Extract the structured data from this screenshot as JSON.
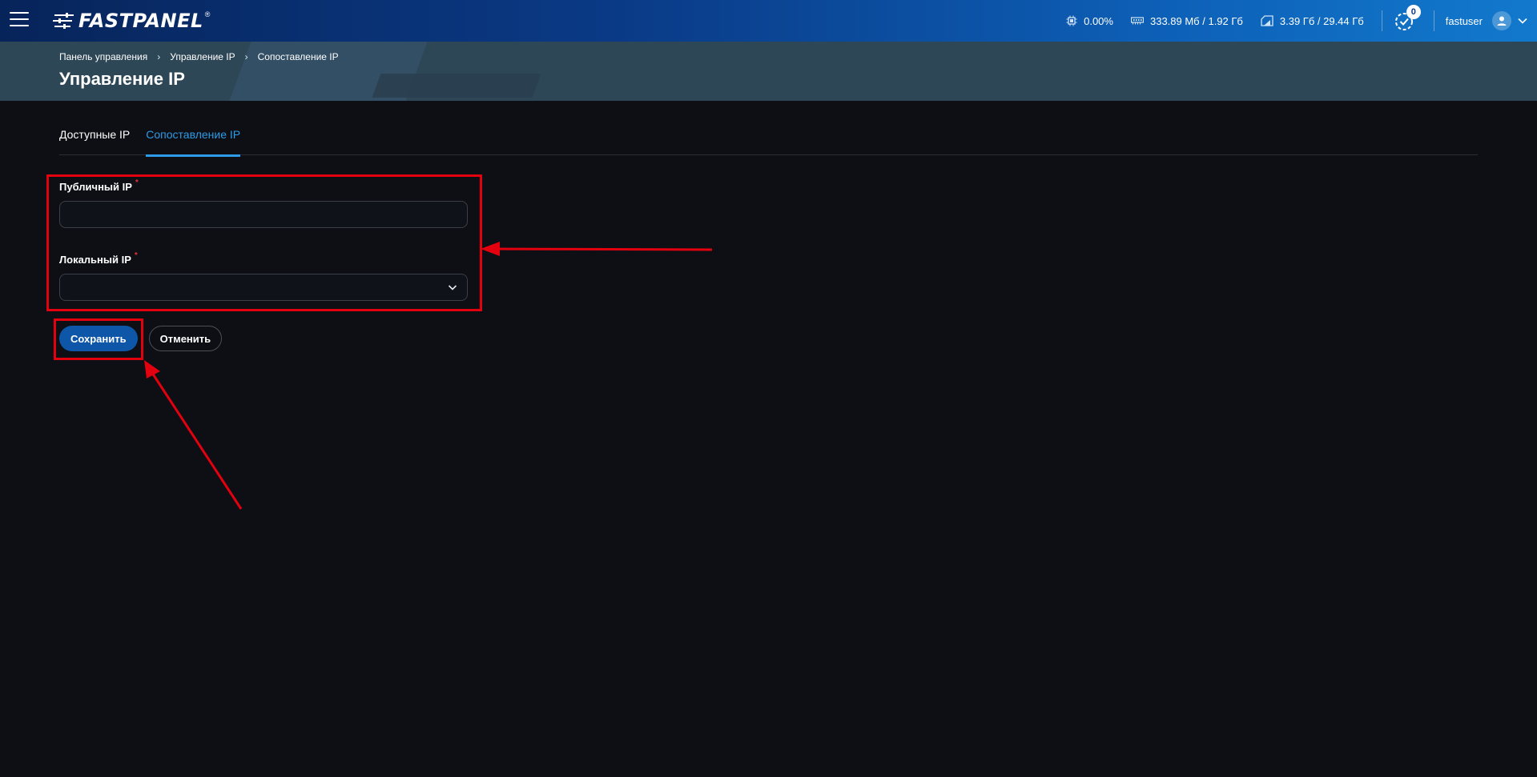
{
  "header": {
    "logo_text": "FASTPANEL",
    "logo_reg": "®",
    "cpu": "0.00%",
    "ram": "333.89 Мб / 1.92 Гб",
    "disk": "3.39 Гб / 29.44 Гб",
    "tasks_count": "0",
    "username": "fastuser",
    "icons": [
      "menu-icon",
      "cpu-icon",
      "ram-icon",
      "disk-icon",
      "tasks-icon",
      "user-icon",
      "chevron-down-icon"
    ]
  },
  "breadcrumb": [
    "Панель управления",
    "Управление IP",
    "Сопоставление IP"
  ],
  "page_title": "Управление IP",
  "tabs": [
    {
      "label": "Доступные IP",
      "active": false
    },
    {
      "label": "Сопоставление IP",
      "active": true
    }
  ],
  "form": {
    "public_ip": {
      "label": "Публичный IP",
      "required_mark": "*",
      "value": ""
    },
    "local_ip": {
      "label": "Локальный IP",
      "required_mark": "*",
      "selected": ""
    }
  },
  "buttons": {
    "save": "Сохранить",
    "cancel": "Отменить"
  },
  "colors": {
    "accent": "#2e9be6",
    "primary_button": "#0d56a8",
    "annotation": "#e3000f",
    "background": "#0d0f14"
  }
}
